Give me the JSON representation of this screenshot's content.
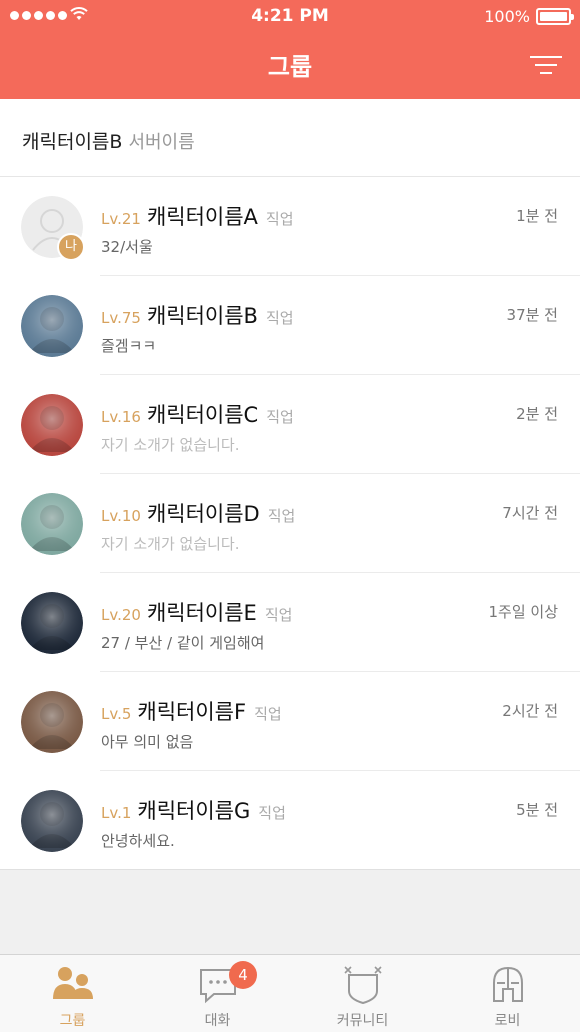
{
  "status_bar": {
    "time": "4:21 PM",
    "battery": "100%"
  },
  "nav": {
    "title": "그룹",
    "menu_icon": "filter-menu-icon"
  },
  "group": {
    "character": "캐릭터이름B",
    "server": "서버이름"
  },
  "members": [
    {
      "level": "Lv.21",
      "name": "캐릭터이름A",
      "job": "직업",
      "time": "1분 전",
      "status": "32/서울",
      "muted": false,
      "me": true,
      "me_label": "나",
      "avatar_color": "#dcdcdc"
    },
    {
      "level": "Lv.75",
      "name": "캐릭터이름B",
      "job": "직업",
      "time": "37분 전",
      "status": "즐겜ㅋㅋ",
      "muted": false,
      "me": false,
      "avatar_color": "#5c7b95"
    },
    {
      "level": "Lv.16",
      "name": "캐릭터이름C",
      "job": "직업",
      "time": "2분 전",
      "status": "자기 소개가 없습니다.",
      "muted": true,
      "me": false,
      "avatar_color": "#b8473f"
    },
    {
      "level": "Lv.10",
      "name": "캐릭터이름D",
      "job": "직업",
      "time": "7시간 전",
      "status": "자기 소개가 없습니다.",
      "muted": true,
      "me": false,
      "avatar_color": "#7fa8a0"
    },
    {
      "level": "Lv.20",
      "name": "캐릭터이름E",
      "job": "직업",
      "time": "1주일 이상",
      "status": "27 / 부산 / 같이 게임해여",
      "muted": false,
      "me": false,
      "avatar_color": "#1f2a3a"
    },
    {
      "level": "Lv.5",
      "name": "캐릭터이름F",
      "job": "직업",
      "time": "2시간 전",
      "status": "아무 의미 없음",
      "muted": false,
      "me": false,
      "avatar_color": "#7a5a46"
    },
    {
      "level": "Lv.1",
      "name": "캐릭터이름G",
      "job": "직업",
      "time": "5분 전",
      "status": "안녕하세요.",
      "muted": false,
      "me": false,
      "avatar_color": "#3a4452"
    }
  ],
  "tabs": [
    {
      "label": "그룹",
      "icon": "group-icon",
      "active": true
    },
    {
      "label": "대화",
      "icon": "chat-icon",
      "active": false,
      "badge": "4"
    },
    {
      "label": "커뮤니티",
      "icon": "community-shield-icon",
      "active": false
    },
    {
      "label": "로비",
      "icon": "helmet-icon",
      "active": false
    }
  ],
  "colors": {
    "header": "#f46a5a",
    "accent": "#d7a25e",
    "badge": "#f06a4e"
  }
}
